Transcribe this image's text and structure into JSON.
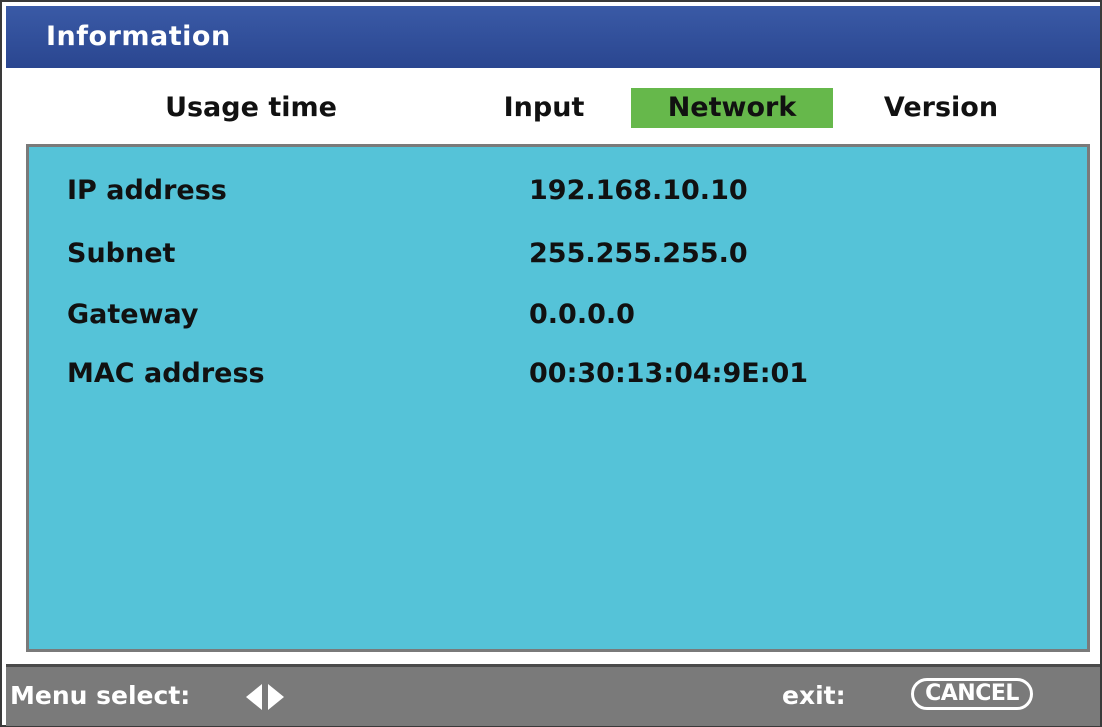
{
  "window": {
    "title": "Information"
  },
  "tabs": [
    {
      "label": "Usage time",
      "active": false
    },
    {
      "label": "Input",
      "active": false
    },
    {
      "label": "Network",
      "active": true
    },
    {
      "label": "Version",
      "active": false
    }
  ],
  "network": {
    "rows": [
      {
        "label": "IP address",
        "value": "192.168.10.10"
      },
      {
        "label": "Subnet",
        "value": "255.255.255.0"
      },
      {
        "label": "Gateway",
        "value": "0.0.0.0"
      },
      {
        "label": "MAC address",
        "value": "00:30:13:04:9E:01"
      }
    ]
  },
  "footer": {
    "menu_select_label": "Menu select:",
    "menu_select_icon": "left-right-arrows-icon",
    "exit_label": "exit:",
    "cancel_label": "CANCEL"
  },
  "colors": {
    "titlebar": "#2a4690",
    "active_tab": "#66b84b",
    "panel": "#55c3d8",
    "statusbar": "#7a7a7a"
  }
}
